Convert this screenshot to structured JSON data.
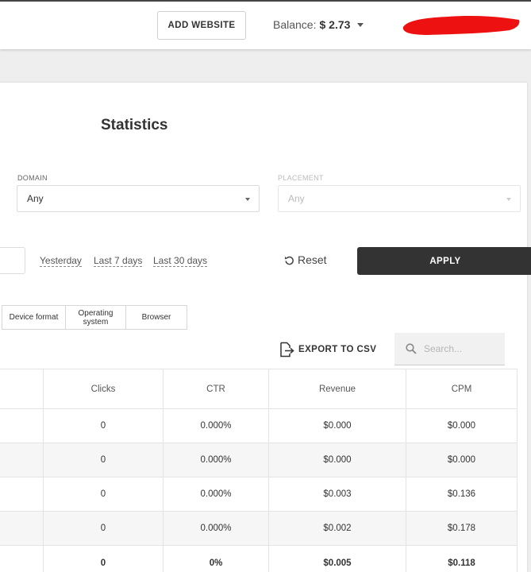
{
  "header": {
    "add_website_label": "ADD WEBSITE",
    "balance_label": "Balance:",
    "balance_value": "$ 2.73",
    "redaction_color": "#ee1111"
  },
  "page": {
    "title": "Statistics"
  },
  "filters": {
    "domain": {
      "label": "DOMAIN",
      "value": "Any"
    },
    "placement": {
      "label": "PLACEMENT",
      "value": "Any",
      "disabled": true
    },
    "quick_ranges": [
      "Yesterday",
      "Last 7 days",
      "Last 30 days"
    ],
    "reset_label": "Reset",
    "apply_label": "APPLY"
  },
  "tabs": [
    {
      "label": "Device format"
    },
    {
      "label": "Operating system"
    },
    {
      "label": "Browser"
    }
  ],
  "toolbar": {
    "export_label": "EXPORT TO CSV",
    "search_placeholder": "Search..."
  },
  "table": {
    "columns": [
      "",
      "Clicks",
      "CTR",
      "Revenue",
      "CPM"
    ],
    "rows": [
      [
        "",
        "0",
        "0.000%",
        "$0.000",
        "$0.000"
      ],
      [
        "",
        "0",
        "0.000%",
        "$0.000",
        "$0.000"
      ],
      [
        "",
        "0",
        "0.000%",
        "$0.003",
        "$0.136"
      ],
      [
        "",
        "0",
        "0.000%",
        "$0.002",
        "$0.178"
      ]
    ],
    "total": [
      "",
      "0",
      "0%",
      "$0.005",
      "$0.118"
    ]
  },
  "colors": {
    "apply_bg": "#333333",
    "page_bg": "#eeeeee",
    "alt_row_bg": "#f6f6f6"
  }
}
